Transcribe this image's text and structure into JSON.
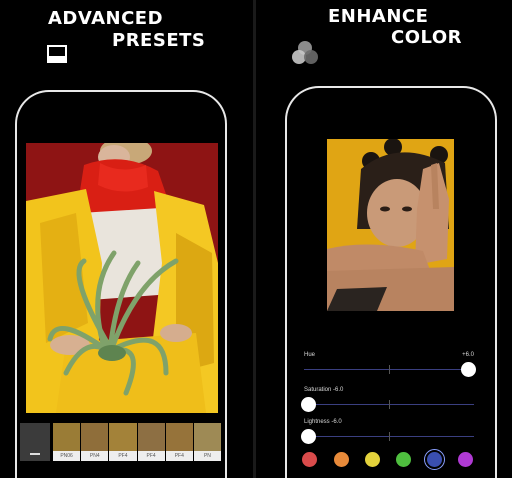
{
  "left_panel": {
    "headline_line1": "ADVANCED",
    "headline_line2": "PRESETS",
    "icon": "frame-icon",
    "preset_tiles": [
      {
        "label": "PN06",
        "color": "#9a7c36"
      },
      {
        "label": "PN4",
        "color": "#8f6e3a"
      },
      {
        "label": "PF4",
        "color": "#a38239"
      },
      {
        "label": "PF4",
        "color": "#8d6f43"
      },
      {
        "label": "PF4",
        "color": "#96733a"
      },
      {
        "label": "PN",
        "color": "#9e8a55"
      }
    ]
  },
  "right_panel": {
    "headline_line1": "ENHANCE",
    "headline_line2": "COLOR",
    "icon": "color-circles-icon",
    "sliders": [
      {
        "label": "Hue",
        "value_text": "+6.0",
        "value": 6.0
      },
      {
        "label": "Saturation  -6.0",
        "value_text": "",
        "value": -6.0
      },
      {
        "label": "Lightness  -6.0",
        "value_text": "",
        "value": -6.0
      }
    ],
    "color_swatches": [
      {
        "name": "red",
        "color": "#d94b4b",
        "selected": false
      },
      {
        "name": "orange",
        "color": "#e88a3a",
        "selected": false
      },
      {
        "name": "yellow",
        "color": "#e3d23c",
        "selected": false
      },
      {
        "name": "green",
        "color": "#4fbf3f",
        "selected": false
      },
      {
        "name": "blue",
        "color": "#3a4fb0",
        "selected": true
      },
      {
        "name": "purple",
        "color": "#b03ad4",
        "selected": false
      }
    ]
  }
}
